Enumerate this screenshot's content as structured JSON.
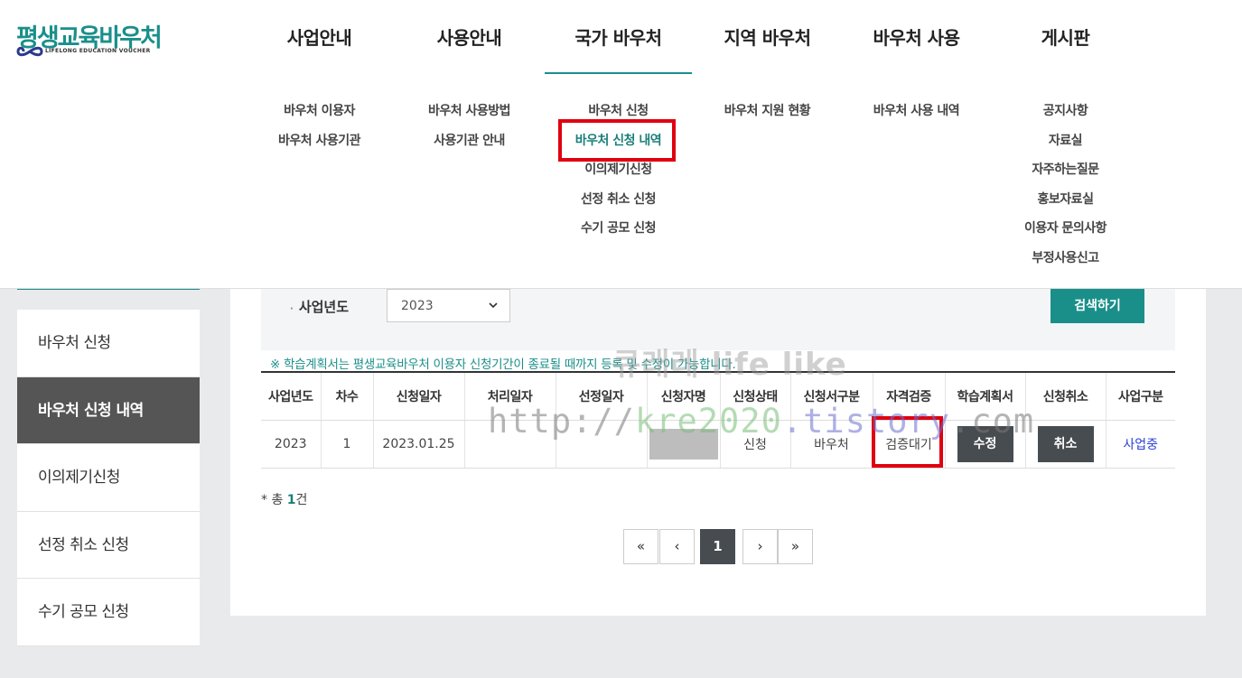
{
  "logo": {
    "title": "평생교육바우처",
    "subtitle": "LIFELONG EDUCATION VOUCHER"
  },
  "gnb": [
    {
      "label": "사업안내",
      "subs": [
        "바우처 이용자",
        "바우처 사용기관"
      ]
    },
    {
      "label": "사용안내",
      "subs": [
        "바우처 사용방법",
        "사용기관 안내"
      ]
    },
    {
      "label": "국가 바우처",
      "subs": [
        "바우처 신청",
        "바우처 신청 내역",
        "이의제기신청",
        "선정 취소 신청",
        "수기 공모 신청"
      ]
    },
    {
      "label": "지역 바우처",
      "subs": [
        "바우처 지원 현황"
      ]
    },
    {
      "label": "바우처 사용",
      "subs": [
        "바우처 사용 내역"
      ]
    },
    {
      "label": "게시판",
      "subs": [
        "공지사항",
        "자료실",
        "자주하는질문",
        "홍보자료실",
        "이용자 문의사항",
        "부정사용신고"
      ]
    }
  ],
  "sidebar": {
    "items": [
      "바우처 신청",
      "바우처 신청 내역",
      "이의제기신청",
      "선정 취소 신청",
      "수기 공모 신청"
    ]
  },
  "search": {
    "label": "사업년도",
    "bullet": "·",
    "year": "2023",
    "button": "검색하기"
  },
  "notice": "※ 학습계획서는 평생교육바우처 이용자 신청기간이 종료될 때까지 등록 및 수정이 가능합니다.",
  "table": {
    "headers": [
      "사업년도",
      "차수",
      "신청일자",
      "처리일자",
      "선정일자",
      "신청자명",
      "신청상태",
      "신청서구분",
      "자격검증",
      "학습계획서",
      "신청취소",
      "사업구분"
    ],
    "row": {
      "year": "2023",
      "round": "1",
      "apply_date": "2023.01.25",
      "process_date": "",
      "select_date": "",
      "status": "신청",
      "form_type": "바우처",
      "verification": "검증대기",
      "plan_button": "수정",
      "cancel_button": "취소",
      "business_type": "사업중"
    }
  },
  "total": {
    "prefix": "* 총 ",
    "count": "1",
    "suffix": "건"
  },
  "pager": {
    "first": "«",
    "prev": "‹",
    "current": "1",
    "next": "›",
    "last": "»"
  },
  "watermark": {
    "line1": "큐래레 life like",
    "line2_a": "http://",
    "line2_b": "kre2020",
    "line2_c": ".tistory",
    "line2_d": ".com"
  },
  "colors": {
    "accent": "#1a8f8a",
    "highlight": "#e0000f",
    "dark_button": "#474c50"
  }
}
